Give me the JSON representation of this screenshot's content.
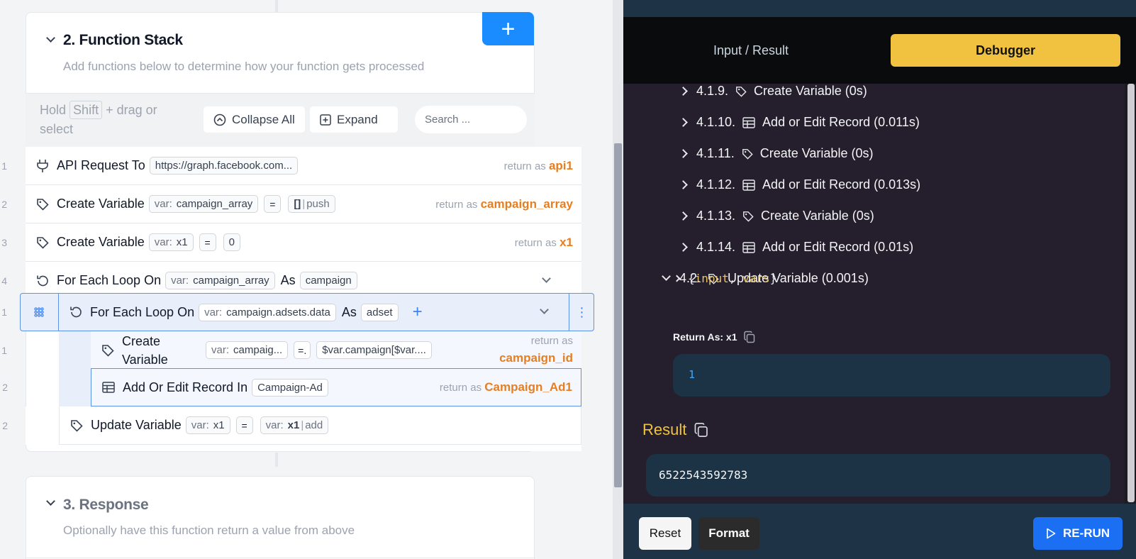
{
  "function_stack": {
    "title": "2. Function Stack",
    "subtitle": "Add functions below to determine how your function gets processed",
    "add_button": "+",
    "toolbar": {
      "hold": "Hold",
      "shift": "Shift",
      "drag_text": "+ drag or select",
      "collapse_all": "Collapse All",
      "expand": "Expand",
      "search_placeholder": "Search ..."
    },
    "return_as_label": "return as",
    "rows": [
      {
        "num": "1",
        "name": "API Request To",
        "arg": "https://graph.facebook.com...",
        "return_as": "api1"
      },
      {
        "num": "2",
        "name": "Create Variable",
        "var_key": "var:",
        "var": "campaign_array",
        "eq": "=",
        "value": "[]",
        "filter": "push",
        "return_as": "campaign_array"
      },
      {
        "num": "3",
        "name": "Create Variable",
        "var_key": "var:",
        "var": "x1",
        "eq": "=",
        "value": "0",
        "return_as": "x1"
      },
      {
        "num": "4",
        "name": "For Each Loop On",
        "var_key": "var:",
        "var": "campaign_array",
        "as_label": "As",
        "item": "campaign"
      },
      {
        "num": "1",
        "name": "For Each Loop On",
        "var_key": "var:",
        "var": "campaign.adsets.data",
        "as_label": "As",
        "item": "adset",
        "plus": "+",
        "menu": "⋮"
      },
      {
        "num": "1",
        "name": "Create Variable",
        "var_key": "var:",
        "var": "campaig...",
        "eq": "=.",
        "value": "$var.campaign[$var....",
        "return_as": "campaign_id"
      },
      {
        "num": "2",
        "name": "Add Or Edit Record In",
        "arg": "Campaign-Ad",
        "return_as": "Campaign_Ad1"
      },
      {
        "num": "2",
        "name": "Update Variable",
        "var_key": "var:",
        "var": "x1",
        "eq": "=",
        "value_key": "var:",
        "value": "x1",
        "filter": "add"
      }
    ]
  },
  "response": {
    "title": "3. Response",
    "subtitle": "Optionally have this function return a value from above"
  },
  "debugger": {
    "tab_input": "Input / Result",
    "tab_debugger": "Debugger",
    "items": [
      {
        "num": "4.1.9.",
        "icon": "tag-icon",
        "label": "Create Variable (0s)"
      },
      {
        "num": "4.1.10.",
        "icon": "table-icon",
        "label": "Add or Edit Record (0.011s)"
      },
      {
        "num": "4.1.11.",
        "icon": "tag-icon",
        "label": "Create Variable (0s)"
      },
      {
        "num": "4.1.12.",
        "icon": "table-icon",
        "label": "Add or Edit Record (0.013s)"
      },
      {
        "num": "4.1.13.",
        "icon": "tag-icon",
        "label": "Create Variable (0s)"
      },
      {
        "num": "4.1.14.",
        "icon": "table-icon",
        "label": "Add or Edit Record (0.01s)"
      },
      {
        "num": "4.2.",
        "icon": "tag-icon",
        "label": "Update Variable (0.001s)"
      }
    ],
    "code_open": "{",
    "code_input": "input",
    "code_comma": ", ",
    "code_vars": "vars",
    "code_close": "}",
    "return_as": "Return As: x1",
    "return_value": "1",
    "result_label": "Result",
    "result_value": "6522543592783",
    "buttons": {
      "reset": "Reset",
      "format": "Format",
      "rerun": "RE-RUN"
    }
  },
  "colors": {
    "accent_blue": "#1a8cff",
    "orange": "#e67e22",
    "yellow": "#f0c240",
    "dark_bg": "#251f2d",
    "navy": "#1e3345"
  }
}
